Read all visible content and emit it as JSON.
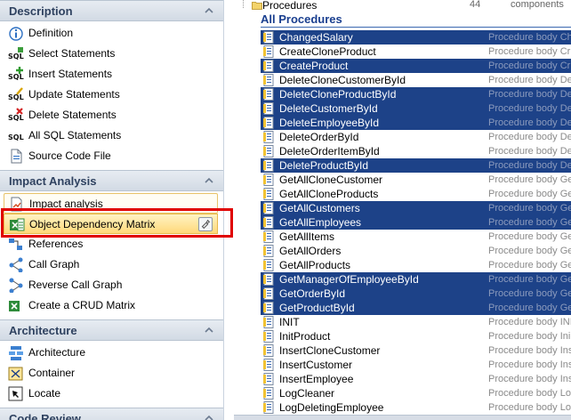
{
  "nav": {
    "sections": [
      {
        "title": "Description",
        "items": [
          {
            "label": "Definition",
            "icon": "info-icon"
          },
          {
            "label": "Select Statements",
            "icon": "sql-select-icon"
          },
          {
            "label": "Insert Statements",
            "icon": "sql-insert-icon"
          },
          {
            "label": "Update Statements",
            "icon": "sql-update-icon"
          },
          {
            "label": "Delete Statements",
            "icon": "sql-delete-icon"
          },
          {
            "label": "All SQL Statements",
            "icon": "sql-icon"
          },
          {
            "label": "Source Code File",
            "icon": "source-file-icon"
          }
        ]
      },
      {
        "title": "Impact Analysis",
        "items": [
          {
            "label": "Impact analysis",
            "icon": "impact-analysis-icon"
          },
          {
            "label": "Object Dependency Matrix",
            "icon": "excel-matrix-icon"
          },
          {
            "label": "References",
            "icon": "references-icon"
          },
          {
            "label": "Call Graph",
            "icon": "call-graph-icon"
          },
          {
            "label": "Reverse Call Graph",
            "icon": "reverse-call-graph-icon"
          },
          {
            "label": "Create a CRUD Matrix",
            "icon": "excel-crud-icon"
          }
        ]
      },
      {
        "title": "Architecture",
        "items": [
          {
            "label": "Architecture",
            "icon": "architecture-icon"
          },
          {
            "label": "Container",
            "icon": "container-icon"
          },
          {
            "label": "Locate",
            "icon": "locate-icon"
          }
        ]
      },
      {
        "title": "Code Review",
        "items": []
      }
    ]
  },
  "tree": {
    "node_label": "Procedures",
    "count": "44",
    "count_label": "components",
    "group_title": "All Procedures",
    "rows": [
      {
        "name": "ChangedSalary",
        "desc": "Procedure body Ch",
        "selected": true
      },
      {
        "name": "CreateCloneProduct",
        "desc": "Procedure body Cr",
        "selected": false
      },
      {
        "name": "CreateProduct",
        "desc": "Procedure body Cr",
        "selected": true
      },
      {
        "name": "DeleteCloneCustomerById",
        "desc": "Procedure body De",
        "selected": false
      },
      {
        "name": "DeleteCloneProductById",
        "desc": "Procedure body De",
        "selected": true
      },
      {
        "name": "DeleteCustomerById",
        "desc": "Procedure body De",
        "selected": true
      },
      {
        "name": "DeleteEmployeeById",
        "desc": "Procedure body De",
        "selected": true
      },
      {
        "name": "DeleteOrderById",
        "desc": "Procedure body De",
        "selected": false
      },
      {
        "name": "DeleteOrderItemById",
        "desc": "Procedure body De",
        "selected": false
      },
      {
        "name": "DeleteProductById",
        "desc": "Procedure body De",
        "selected": true
      },
      {
        "name": "GetAllCloneCustomer",
        "desc": "Procedure body Ge",
        "selected": false
      },
      {
        "name": "GetAllCloneProducts",
        "desc": "Procedure body Ge",
        "selected": false
      },
      {
        "name": "GetAllCustomers",
        "desc": "Procedure body Ge",
        "selected": true
      },
      {
        "name": "GetAllEmployees",
        "desc": "Procedure body Ge",
        "selected": true
      },
      {
        "name": "GetAllItems",
        "desc": "Procedure body Ge",
        "selected": false
      },
      {
        "name": "GetAllOrders",
        "desc": "Procedure body Ge",
        "selected": false
      },
      {
        "name": "GetAllProducts",
        "desc": "Procedure body Ge",
        "selected": false
      },
      {
        "name": "GetManagerOfEmployeeById",
        "desc": "Procedure body Ge",
        "selected": true
      },
      {
        "name": "GetOrderById",
        "desc": "Procedure body Ge",
        "selected": true
      },
      {
        "name": "GetProductById",
        "desc": "Procedure body Ge",
        "selected": true
      },
      {
        "name": "INIT",
        "desc": "Procedure body INI",
        "selected": false
      },
      {
        "name": "InitProduct",
        "desc": "Procedure body Ini",
        "selected": false
      },
      {
        "name": "InsertCloneCustomer",
        "desc": "Procedure body Ins",
        "selected": false
      },
      {
        "name": "InsertCustomer",
        "desc": "Procedure body Ins",
        "selected": false
      },
      {
        "name": "InsertEmployee",
        "desc": "Procedure body Ins",
        "selected": false
      },
      {
        "name": "LogCleaner",
        "desc": "Procedure body Lo",
        "selected": false
      },
      {
        "name": "LogDeletingEmployee",
        "desc": "Procedure body Lo",
        "selected": false
      }
    ]
  },
  "colors": {
    "selection": "#1d4288",
    "highlight": "#e00000",
    "group_title": "#1a3f8f"
  }
}
